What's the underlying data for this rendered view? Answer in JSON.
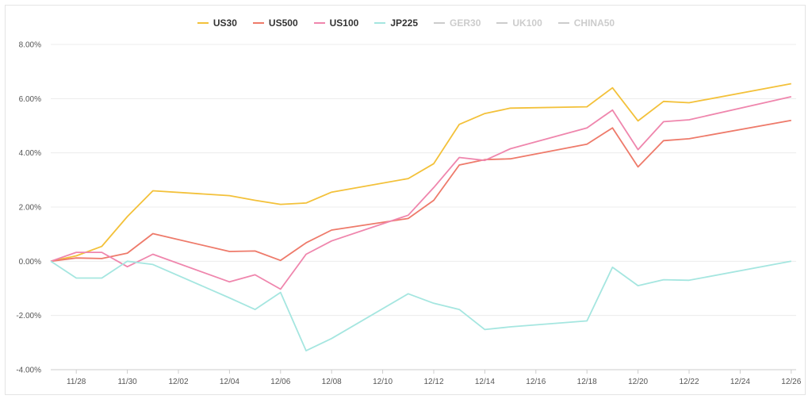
{
  "chart_data": {
    "type": "line",
    "title": "",
    "xlabel": "",
    "ylabel": "",
    "ylim": [
      -4,
      8
    ],
    "y_ticks": [
      -4,
      -2,
      0,
      2,
      4,
      6,
      8
    ],
    "y_tick_labels": [
      "-4.00%",
      "-2.00%",
      "0.00%",
      "2.00%",
      "4.00%",
      "6.00%",
      "8.00%"
    ],
    "x_tick_labels": [
      "11/28",
      "11/30",
      "12/02",
      "12/04",
      "12/06",
      "12/08",
      "12/10",
      "12/12",
      "12/14",
      "12/16",
      "12/18",
      "12/20",
      "12/22",
      "12/24",
      "12/26"
    ],
    "x_days": [
      "11/27",
      "11/28",
      "11/29",
      "11/30",
      "12/01",
      "12/04",
      "12/05",
      "12/06",
      "12/07",
      "12/08",
      "12/11",
      "12/12",
      "12/13",
      "12/14",
      "12/15",
      "12/18",
      "12/19",
      "12/20",
      "12/21",
      "12/22",
      "12/26"
    ],
    "grid": "horizontal",
    "legend_position": "top-center",
    "series": [
      {
        "name": "US30",
        "color": "#f3c13a",
        "visible": true,
        "values": [
          0.0,
          0.2,
          0.55,
          1.65,
          2.6,
          2.42,
          2.25,
          2.1,
          2.15,
          2.55,
          3.05,
          3.6,
          5.05,
          5.45,
          5.65,
          5.7,
          6.4,
          5.18,
          5.9,
          5.85,
          6.55
        ]
      },
      {
        "name": "US500",
        "color": "#ee7a6a",
        "visible": true,
        "values": [
          0.0,
          0.12,
          0.1,
          0.3,
          1.02,
          0.36,
          0.38,
          0.03,
          0.68,
          1.15,
          1.58,
          2.25,
          3.55,
          3.75,
          3.78,
          4.32,
          4.92,
          3.48,
          4.45,
          4.52,
          5.2
        ]
      },
      {
        "name": "US100",
        "color": "#ef86ad",
        "visible": true,
        "values": [
          0.0,
          0.33,
          0.33,
          -0.2,
          0.26,
          -0.76,
          -0.5,
          -1.03,
          0.26,
          0.75,
          1.7,
          2.72,
          3.83,
          3.72,
          4.15,
          4.92,
          5.58,
          4.12,
          5.15,
          5.22,
          6.07
        ]
      },
      {
        "name": "JP225",
        "color": "#a5e6e0",
        "visible": true,
        "values": [
          0.0,
          -0.62,
          -0.62,
          0.0,
          -0.12,
          -1.35,
          -1.78,
          -1.15,
          -3.3,
          -2.85,
          -1.2,
          -1.55,
          -1.78,
          -2.52,
          -2.42,
          -2.2,
          -0.22,
          -0.9,
          -0.68,
          -0.7,
          0.0
        ]
      },
      {
        "name": "GER30",
        "color": "#cccccc",
        "visible": false,
        "values": []
      },
      {
        "name": "UK100",
        "color": "#cccccc",
        "visible": false,
        "values": []
      },
      {
        "name": "CHINA50",
        "color": "#cccccc",
        "visible": false,
        "values": []
      }
    ]
  }
}
